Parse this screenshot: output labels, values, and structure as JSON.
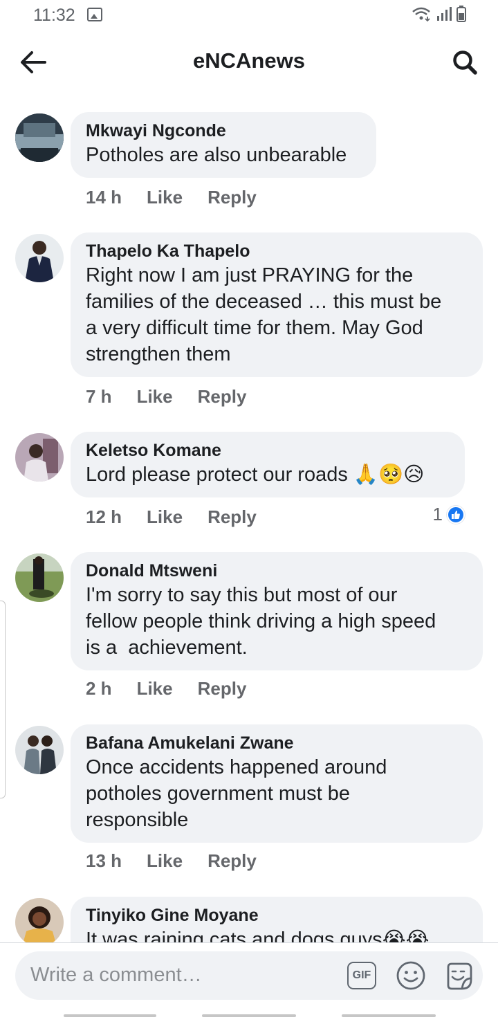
{
  "status_bar": {
    "time": "11:32"
  },
  "header": {
    "title": "eNCAnews"
  },
  "comments": [
    {
      "author": "Mkwayi Ngconde",
      "text": "Potholes are also unbearable",
      "time": "14 h",
      "like_label": "Like",
      "reply_label": "Reply"
    },
    {
      "author": "Thapelo Ka Thapelo",
      "text": "Right now I am just PRAYING for the\nfamilies of the deceased … this must be\na very difficult time for them. May God\nstrengthen them",
      "time": "7 h",
      "like_label": "Like",
      "reply_label": "Reply"
    },
    {
      "author": "Keletso Komane",
      "text": "Lord please protect our roads 🙏🥺😥",
      "time": "12 h",
      "like_label": "Like",
      "reply_label": "Reply",
      "reaction_count": "1"
    },
    {
      "author": "Donald Mtsweni",
      "text": "I'm sorry to say this but most of our\nfellow people think driving a high speed\nis a  achievement.",
      "time": "2 h",
      "like_label": "Like",
      "reply_label": "Reply"
    },
    {
      "author": "Bafana Amukelani Zwane",
      "text": "Once accidents happened around\npotholes government must be\nresponsible",
      "time": "13 h",
      "like_label": "Like",
      "reply_label": "Reply"
    },
    {
      "author": "Tinyiko Gine Moyane",
      "text": "It was raining cats and dogs guys😭😭"
    }
  ],
  "composer": {
    "placeholder": "Write a comment…",
    "gif_label": "GIF"
  },
  "icons": {
    "back": "arrow-left-icon",
    "search": "search-icon",
    "emoji": "smiley-icon",
    "sticker": "sticker-icon",
    "like_reaction": "thumbs-up-icon"
  },
  "colors": {
    "like_blue": "#1877f2",
    "bubble_bg": "#f0f2f5",
    "meta_gray": "#65676b"
  }
}
